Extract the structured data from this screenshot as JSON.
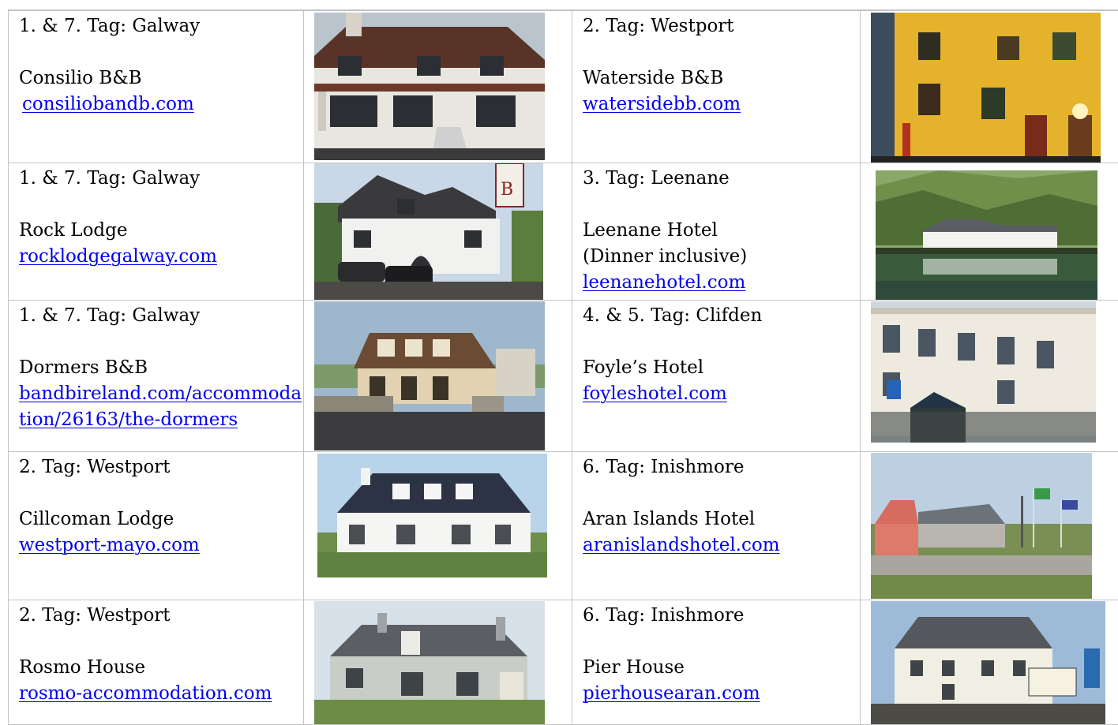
{
  "rows": [
    {
      "left": {
        "day": "1. & 7. Tag: Galway",
        "name": "Consilio B&B",
        "name_extra": "",
        "link": "consiliobandb.com",
        "photo": "consilio-bb-photo"
      },
      "right": {
        "day": "2. Tag: Westport",
        "name": "Waterside B&B",
        "name_extra": "",
        "link": "watersidebb.com",
        "photo": "waterside-bb-photo"
      }
    },
    {
      "left": {
        "day": "1. & 7. Tag: Galway",
        "name": "Rock Lodge",
        "name_extra": "",
        "link": "rocklodgegalway.com",
        "photo": "rock-lodge-photo"
      },
      "right": {
        "day": "3. Tag: Leenane",
        "name": "Leenane Hotel",
        "name_extra": "(Dinner inclusive)",
        "link": "leenanehotel.com",
        "photo": "leenane-hotel-photo"
      }
    },
    {
      "left": {
        "day": "1. & 7. Tag: Galway",
        "name": "Dormers B&B",
        "name_extra": "",
        "link": "bandbireland.com/accommodation/26163/the-dormers",
        "photo": "dormers-bb-photo"
      },
      "right": {
        "day": "4. & 5. Tag: Clifden",
        "name": "Foyle’s Hotel",
        "name_extra": "",
        "link": "foyleshotel.com",
        "photo": "foyles-hotel-photo"
      }
    },
    {
      "left": {
        "day": "2. Tag: Westport",
        "name": "Cillcoman Lodge",
        "name_extra": "",
        "link": "westport-mayo.com",
        "photo": "cillcoman-lodge-photo"
      },
      "right": {
        "day": "6. Tag: Inishmore",
        "name": "Aran Islands Hotel",
        "name_extra": "",
        "link": "aranislandshotel.com",
        "photo": "aran-islands-hotel-photo"
      }
    },
    {
      "left": {
        "day": "2. Tag: Westport",
        "name": "Rosmo House",
        "name_extra": "",
        "link": "rosmo-accommodation.com",
        "photo": "rosmo-house-photo"
      },
      "right": {
        "day": "6. Tag: Inishmore",
        "name": "Pier House",
        "name_extra": "",
        "link": "pierhousearan.com",
        "photo": "pier-house-photo"
      }
    }
  ],
  "colors": {
    "link": "#0000ee",
    "border": "#c4c4c4",
    "text": "#000000"
  }
}
